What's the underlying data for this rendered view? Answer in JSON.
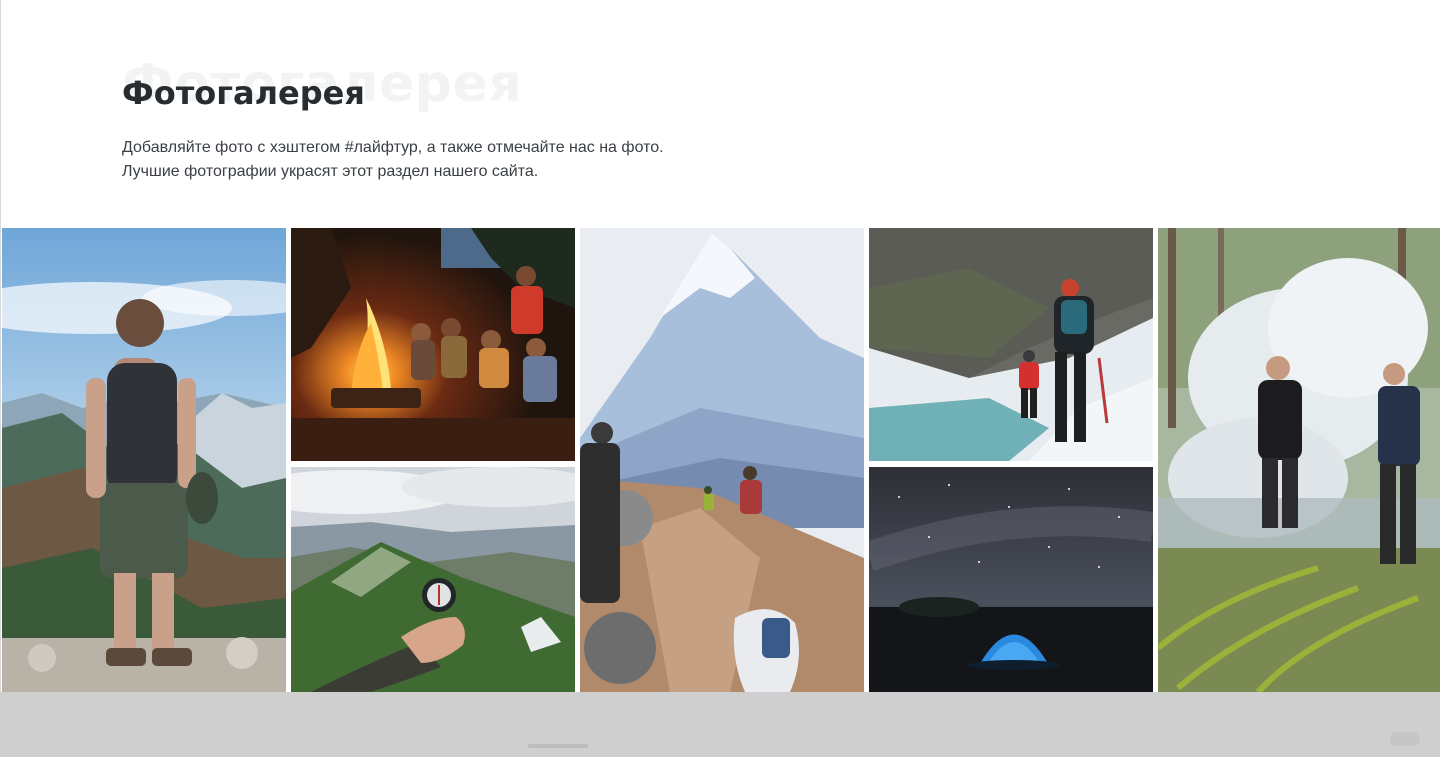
{
  "section": {
    "ghost_title": "Фотогалерея",
    "title": "Фотогалерея",
    "subtitle_line1": "Добавляйте фото с хэштегом #лайфтур, а также отмечайте нас на фото.",
    "subtitle_line2": "Лучшие фотографии украсят этот раздел нашего сайта."
  },
  "gallery": {
    "photos": [
      {
        "subject": "hiker-mountain-view"
      },
      {
        "subject": "campfire-group"
      },
      {
        "subject": "compass-in-hand"
      },
      {
        "subject": "volcano-trail"
      },
      {
        "subject": "snow-canyon-hikers"
      },
      {
        "subject": "tent-night-sky"
      },
      {
        "subject": "men-smoke-forest"
      }
    ]
  },
  "colors": {
    "title": "#272c30",
    "ghost": "#f2f4f4",
    "text": "#3a3f44",
    "band": "#cfcfcf"
  }
}
